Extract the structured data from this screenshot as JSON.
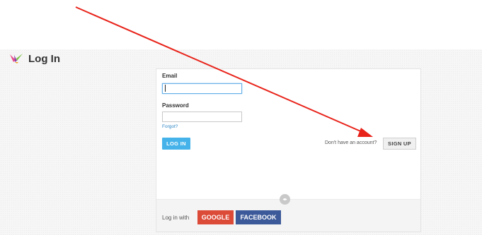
{
  "header": {
    "title": "Log In",
    "logo_icon": "bird-logo-icon"
  },
  "form": {
    "email_label": "Email",
    "email_value": "",
    "password_label": "Password",
    "password_value": "",
    "forgot_link": "Forgot?",
    "login_button": "LOG IN",
    "no_account_text": "Don't have an account?",
    "signup_button": "SIGN UP"
  },
  "social": {
    "or_icon": "or-divider-icon",
    "login_with_text": "Log in with",
    "google_button": "GOOGLE",
    "facebook_button": "FACEBOOK"
  },
  "colors": {
    "login_button": "#45b3ea",
    "google": "#dc4a38",
    "facebook": "#3c5a99",
    "annotation_arrow": "#e8231a",
    "link": "#2c86c4"
  },
  "annotation": {
    "type": "red-arrow",
    "points_to": "signup-button"
  }
}
